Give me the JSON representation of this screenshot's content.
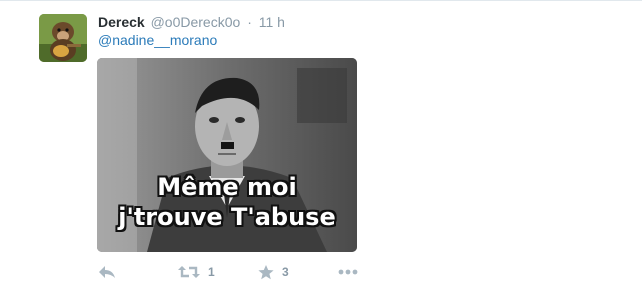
{
  "tweet": {
    "fullname": "Dereck",
    "username": "@o0Dereck0o",
    "separator": "·",
    "time": "11 h",
    "text": "@nadine__morano",
    "media": {
      "caption_line1": "Même moi",
      "caption_line2": "j'trouve T'abuse"
    },
    "actions": {
      "reply_icon": "reply-icon",
      "retweet_icon": "retweet-icon",
      "retweet_count": "1",
      "favorite_icon": "star-icon",
      "favorite_count": "3",
      "more_icon": "more-dots-icon"
    }
  }
}
